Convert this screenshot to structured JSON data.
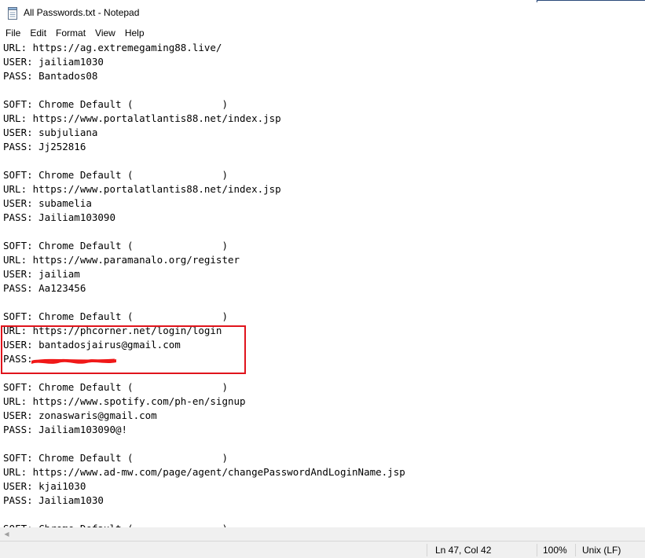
{
  "window": {
    "title": "All Passwords.txt - Notepad",
    "icon": "notepad-icon"
  },
  "menu": {
    "items": [
      "File",
      "Edit",
      "Format",
      "View",
      "Help"
    ]
  },
  "document": {
    "lines": [
      "URL: https://ag.extremegaming88.live/",
      "USER: jailiam1030",
      "PASS: Bantados08",
      "",
      "SOFT: Chrome Default (               )",
      "URL: https://www.portalatlantis88.net/index.jsp",
      "USER: subjuliana",
      "PASS: Jj252816",
      "",
      "SOFT: Chrome Default (               )",
      "URL: https://www.portalatlantis88.net/index.jsp",
      "USER: subamelia",
      "PASS: Jailiam103090",
      "",
      "SOFT: Chrome Default (               )",
      "URL: https://www.paramanalo.org/register",
      "USER: jailiam",
      "PASS: Aa123456",
      "",
      "SOFT: Chrome Default (               )",
      "URL: https://phcorner.net/login/login",
      "USER: bantadosjairus@gmail.com",
      "PASS:",
      "",
      "SOFT: Chrome Default (               )",
      "URL: https://www.spotify.com/ph-en/signup",
      "USER: zonaswaris@gmail.com",
      "PASS: Jailiam103090@!",
      "",
      "SOFT: Chrome Default (               )",
      "URL: https://www.ad-mw.com/page/agent/changePasswordAndLoginName.jsp",
      "USER: kjai1030",
      "PASS: Jailiam1030",
      "",
      "SOFT: Chrome Default (               )"
    ],
    "highlight_color": "#e0141c",
    "redaction_color": "#f01818"
  },
  "status": {
    "position": "Ln 47, Col 42",
    "zoom": "100%",
    "line_ending": "Unix (LF)"
  }
}
